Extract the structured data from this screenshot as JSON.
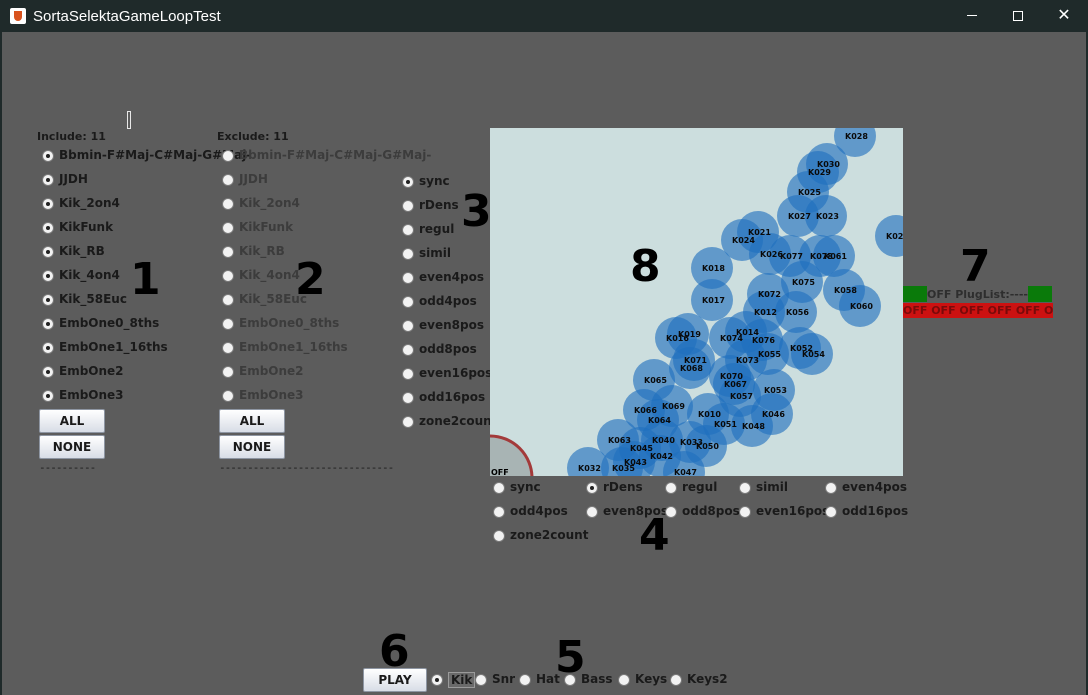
{
  "window": {
    "title": "SortaSelektaGameLoopTest"
  },
  "include": {
    "label": "Include: 11",
    "items": [
      {
        "label": "Bbmin-F#Maj-C#Maj-G#Maj-",
        "checked": true
      },
      {
        "label": "JJDH",
        "checked": true
      },
      {
        "label": "Kik_2on4",
        "checked": true
      },
      {
        "label": "KikFunk",
        "checked": true
      },
      {
        "label": "Kik_RB",
        "checked": true
      },
      {
        "label": "Kik_4on4",
        "checked": true
      },
      {
        "label": "Kik_58Euc",
        "checked": true
      },
      {
        "label": "EmbOne0_8ths",
        "checked": true
      },
      {
        "label": "EmbOne1_16ths",
        "checked": true
      },
      {
        "label": "EmbOne2",
        "checked": true
      },
      {
        "label": "EmbOne3",
        "checked": true
      }
    ],
    "all_label": "ALL",
    "none_label": "NONE",
    "divider": "----------"
  },
  "exclude": {
    "label": "Exclude: 11",
    "items": [
      {
        "label": "Bbmin-F#Maj-C#Maj-G#Maj-",
        "checked": false
      },
      {
        "label": "JJDH",
        "checked": false
      },
      {
        "label": "Kik_2on4",
        "checked": false
      },
      {
        "label": "KikFunk",
        "checked": false
      },
      {
        "label": "Kik_RB",
        "checked": false
      },
      {
        "label": "Kik_4on4",
        "checked": false
      },
      {
        "label": "Kik_58Euc",
        "checked": false
      },
      {
        "label": "EmbOne0_8ths",
        "checked": false
      },
      {
        "label": "EmbOne1_16ths",
        "checked": false
      },
      {
        "label": "EmbOne2",
        "checked": false
      },
      {
        "label": "EmbOne3",
        "checked": false
      }
    ],
    "all_label": "ALL",
    "none_label": "NONE",
    "divider": "-------------------------------"
  },
  "mode_list": {
    "items": [
      {
        "label": "sync",
        "checked": true
      },
      {
        "label": "rDens",
        "checked": false
      },
      {
        "label": "regul",
        "checked": false
      },
      {
        "label": "simil",
        "checked": false
      },
      {
        "label": "even4pos",
        "checked": false
      },
      {
        "label": "odd4pos",
        "checked": false
      },
      {
        "label": "even8pos",
        "checked": false
      },
      {
        "label": "odd8pos",
        "checked": false
      },
      {
        "label": "even16pos",
        "checked": false
      },
      {
        "label": "odd16pos",
        "checked": false
      },
      {
        "label": "zone2count",
        "checked": false
      }
    ]
  },
  "axis_modes": {
    "items": [
      {
        "label": "sync",
        "checked": false
      },
      {
        "label": "rDens",
        "checked": true
      },
      {
        "label": "regul",
        "checked": false
      },
      {
        "label": "simil",
        "checked": false
      },
      {
        "label": "even4pos",
        "checked": false
      },
      {
        "label": "odd4pos",
        "checked": false
      },
      {
        "label": "even8pos",
        "checked": false
      },
      {
        "label": "odd8pos",
        "checked": false
      },
      {
        "label": "even16pos",
        "checked": false
      },
      {
        "label": "odd16pos",
        "checked": false
      },
      {
        "label": "zone2count",
        "checked": false
      }
    ]
  },
  "canvas": {
    "off_label": "OFF",
    "circle_color": "#1f6fbf",
    "background": "#ccdede",
    "nodes": [
      {
        "id": "K028"
      },
      {
        "id": "K030"
      },
      {
        "id": "K029"
      },
      {
        "id": "K025"
      },
      {
        "id": "K027"
      },
      {
        "id": "K023"
      },
      {
        "id": "K021"
      },
      {
        "id": "K02"
      },
      {
        "id": "K024"
      },
      {
        "id": "K026"
      },
      {
        "id": "K077"
      },
      {
        "id": "K078"
      },
      {
        "id": "K061"
      },
      {
        "id": "K018"
      },
      {
        "id": "K075"
      },
      {
        "id": "K058"
      },
      {
        "id": "K072"
      },
      {
        "id": "K017"
      },
      {
        "id": "K060"
      },
      {
        "id": "K056"
      },
      {
        "id": "K012"
      },
      {
        "id": "K014"
      },
      {
        "id": "K016"
      },
      {
        "id": "K019"
      },
      {
        "id": "K074"
      },
      {
        "id": "K076"
      },
      {
        "id": "K052"
      },
      {
        "id": "K054"
      },
      {
        "id": "K071"
      },
      {
        "id": "K068"
      },
      {
        "id": "K055"
      },
      {
        "id": "K073"
      },
      {
        "id": "K065"
      },
      {
        "id": "K070"
      },
      {
        "id": "K053"
      },
      {
        "id": "K067"
      },
      {
        "id": "K057"
      },
      {
        "id": "K069"
      },
      {
        "id": "K066"
      },
      {
        "id": "K064"
      },
      {
        "id": "K010"
      },
      {
        "id": "K046"
      },
      {
        "id": "K051"
      },
      {
        "id": "K048"
      },
      {
        "id": "K063"
      },
      {
        "id": "K040"
      },
      {
        "id": "K033"
      },
      {
        "id": "K050"
      },
      {
        "id": "K042"
      },
      {
        "id": "K035"
      },
      {
        "id": "K032"
      },
      {
        "id": "K047"
      },
      {
        "id": "K045"
      },
      {
        "id": "K043"
      }
    ]
  },
  "plug": {
    "label": "OFF PlugList:-------",
    "off_strip": "OFF OFF OFF OFF OFF OFF OFF"
  },
  "transport": {
    "play_label": "PLAY",
    "tracks": [
      {
        "label": "Kik",
        "checked": true
      },
      {
        "label": "Snr",
        "checked": false
      },
      {
        "label": "Hat",
        "checked": false
      },
      {
        "label": "Bass",
        "checked": false
      },
      {
        "label": "Keys",
        "checked": false
      },
      {
        "label": "Keys2",
        "checked": false
      }
    ]
  },
  "annotations": [
    "1",
    "2",
    "3",
    "4",
    "5",
    "6",
    "7",
    "8"
  ]
}
